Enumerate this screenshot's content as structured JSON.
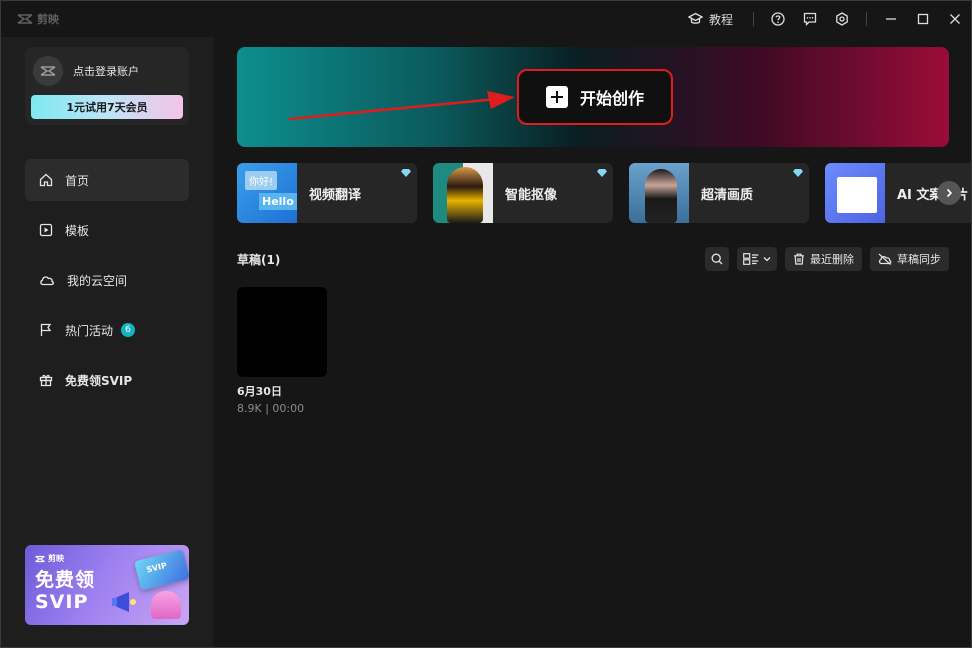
{
  "app": {
    "brand": "剪映"
  },
  "titlebar": {
    "tutorial_label": "教程"
  },
  "account": {
    "login_text": "点击登录账户",
    "trial_label": "1元试用7天会员"
  },
  "nav": {
    "items": [
      {
        "label": "首页",
        "icon": "home-icon",
        "active": true
      },
      {
        "label": "模板",
        "icon": "template-icon"
      },
      {
        "label": "我的云空间",
        "icon": "cloud-icon"
      },
      {
        "label": "热门活动",
        "icon": "flag-icon",
        "badge": "6"
      },
      {
        "label": "免费领SVIP",
        "icon": "gift-icon"
      }
    ]
  },
  "promo": {
    "brand": "剪映",
    "title_line1": "免费领",
    "title_line2": "SVIP",
    "card_text": "SVIP"
  },
  "hero": {
    "start_label": "开始创作",
    "annotation_color": "#e01d1d"
  },
  "tools": [
    {
      "label": "视频翻译",
      "thumb_text1": "你好!",
      "thumb_text2": "Hello"
    },
    {
      "label": "智能抠像"
    },
    {
      "label": "超清画质"
    },
    {
      "label": "AI 文案成片"
    }
  ],
  "drafts": {
    "title": "草稿(1)",
    "recent_delete_label": "最近删除",
    "sync_label": "草稿同步",
    "items": [
      {
        "name": "6月30日",
        "meta": "8.9K | 00:00"
      }
    ]
  },
  "colors": {
    "accent_teal": "#14b3c2",
    "background": "#161616",
    "sidebar": "#1e1e1e"
  }
}
